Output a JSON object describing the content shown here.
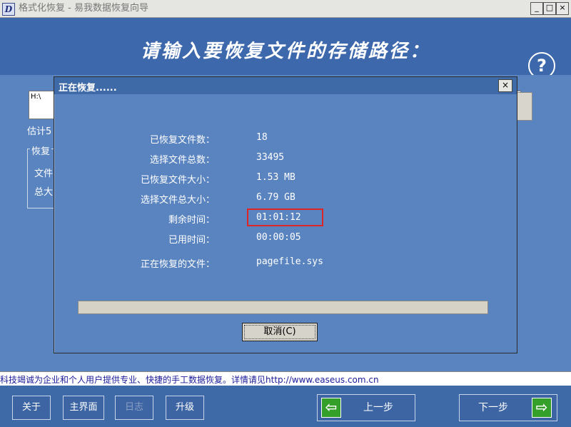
{
  "window": {
    "icon_letter": "D",
    "title": "格式化恢复 - 易我数据恢复向导",
    "minimize_glyph": "_",
    "maximize_glyph": "□",
    "close_glyph": "×"
  },
  "header": {
    "title": "请输入要恢复文件的存储路径：",
    "help_glyph": "?"
  },
  "main": {
    "path_value": "H:\\",
    "estimate_label": "估计5",
    "group_legend": "恢复",
    "group_line1": "文件",
    "group_line2": "总大"
  },
  "dialog": {
    "title": "正在恢复......",
    "close_glyph": "×",
    "rows": [
      {
        "label": "已恢复文件数：",
        "value": "18"
      },
      {
        "label": "选择文件总数：",
        "value": "33495"
      },
      {
        "label": "已恢复文件大小：",
        "value": "1.53 MB"
      },
      {
        "label": "选择文件总大小：",
        "value": "6.79 GB"
      },
      {
        "label": "剩余时间：",
        "value": "01:01:12"
      },
      {
        "label": "已用时间：",
        "value": "00:00:05"
      },
      {
        "label": "正在恢复的文件：",
        "value": "pagefile.sys"
      }
    ],
    "progress": 0.0,
    "cancel_label": "取消(C)",
    "highlight_color": "#e02525"
  },
  "statusbar": {
    "text": "科技竭诚为企业和个人用户提供专业、快捷的手工数据恢复。详情请见http://www.easeus.com.cn"
  },
  "footer": {
    "about_label": "关于",
    "main_label": "主界面",
    "log_label": "日志",
    "upgrade_label": "升级",
    "prev_label": "上一步",
    "next_label": "下一步",
    "prev_glyph": "⇦",
    "next_glyph": "⇨"
  },
  "colors": {
    "panel_blue": "#5a84c0",
    "header_blue": "#3d69ac",
    "arrow_green": "#34a02a"
  }
}
